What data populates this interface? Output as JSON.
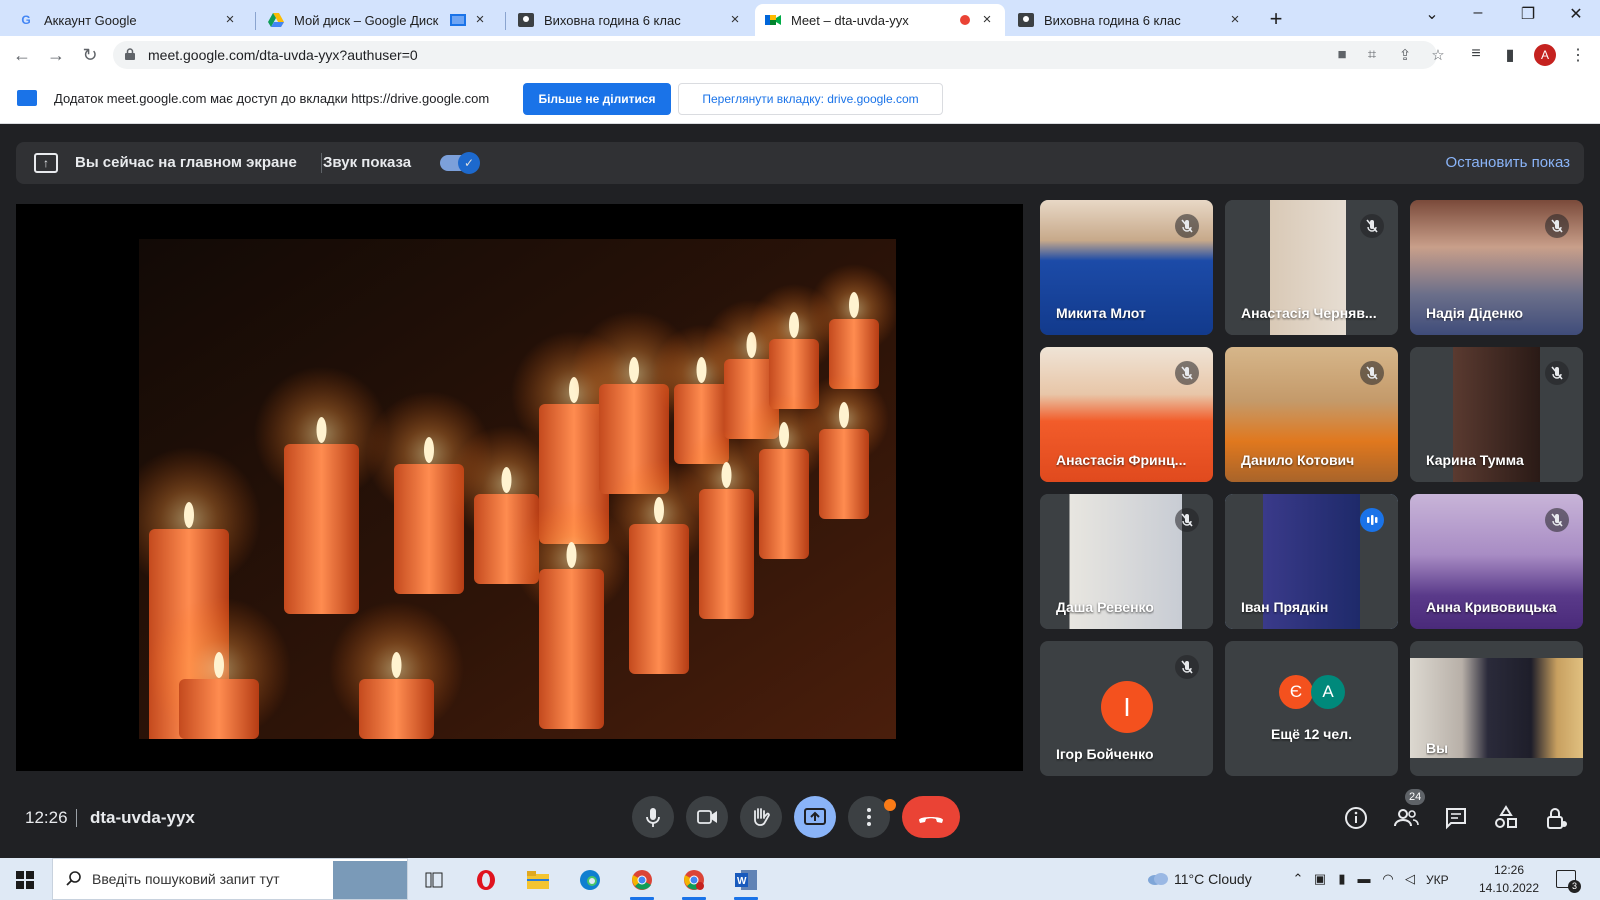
{
  "browser": {
    "tabs": [
      {
        "title": "Аккаунт Google",
        "icon": "google-g-icon"
      },
      {
        "title": "Мой диск – Google Диск",
        "icon": "google-drive-icon"
      },
      {
        "title": "Виховна година 6 клас",
        "icon": "classroom-icon"
      },
      {
        "title": "Meet – dta-uvda-yyx",
        "icon": "google-meet-icon",
        "recording": true
      },
      {
        "title": "Виховна година 6 клас",
        "icon": "classroom-icon"
      }
    ],
    "active_tab_index": 3,
    "url": "meet.google.com/dta-uvda-yyx?authuser=0",
    "profile_initial": "A"
  },
  "infobar": {
    "message": "Додаток meet.google.com має доступ до вкладки https://drive.google.com",
    "stop_sharing": "Більше не ділитися",
    "view_tab": "Переглянути вкладку: drive.google.com"
  },
  "banner": {
    "presenting_text": "Вы сейчас на главном экране",
    "audio_label": "Звук показа",
    "audio_enabled": true,
    "stop_presenting": "Остановить показ"
  },
  "participants": [
    {
      "name": "Микита Млот",
      "muted": true
    },
    {
      "name": "Анастасія Черняв...",
      "muted": true
    },
    {
      "name": "Надія Діденко",
      "muted": true
    },
    {
      "name": "Анастасія Фринц...",
      "muted": true
    },
    {
      "name": "Данило Котович",
      "muted": true
    },
    {
      "name": "Карина Тумма",
      "muted": true
    },
    {
      "name": "Даша Ревенко",
      "muted": true
    },
    {
      "name": "Іван Прядкін",
      "muted": false,
      "speaking": true
    },
    {
      "name": "Анна Кривовицька",
      "muted": true
    },
    {
      "name": "Ігор Бойченко",
      "muted": true,
      "avatar_initial": "І"
    },
    {
      "name": "Ещё 12 чел.",
      "avatars": [
        "Є",
        "А"
      ]
    },
    {
      "name": "Вы"
    }
  ],
  "meeting": {
    "time": "12:26",
    "code": "dta-uvda-yyx",
    "people_count": "24"
  },
  "controls": [
    "mic-icon",
    "camera-icon",
    "raise-hand-icon",
    "present-screen-icon",
    "more-options-icon",
    "end-call-icon"
  ],
  "right_controls": [
    "info-icon",
    "people-icon",
    "chat-icon",
    "activities-icon",
    "host-controls-icon"
  ],
  "taskbar": {
    "search_placeholder": "Введіть пошуковий запит тут",
    "weather": "11°C  Cloudy",
    "language": "УКР",
    "time": "12:26",
    "date": "14.10.2022",
    "notifications": "3"
  },
  "colors": {
    "meet_bg": "#202124",
    "accent_blue": "#1a73e8",
    "end_call_red": "#ea4335",
    "light_blue": "#8ab4f8"
  }
}
